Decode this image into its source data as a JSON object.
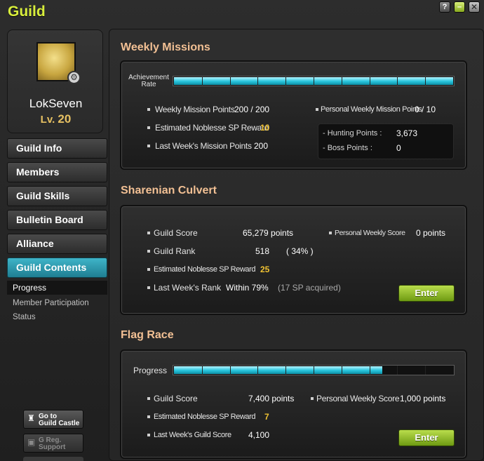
{
  "window": {
    "title": "Guild",
    "help": "?",
    "minimize": "–",
    "close": "✕"
  },
  "profile": {
    "name": "LokSeven",
    "level_prefix": "Lv.",
    "level": "20"
  },
  "nav": {
    "items": [
      "Guild Info",
      "Members",
      "Guild Skills",
      "Bulletin Board",
      "Alliance",
      "Guild Contents"
    ],
    "active": "Guild Contents",
    "sub": [
      "Progress",
      "Member Participation Status"
    ]
  },
  "bottom_buttons": {
    "castle": [
      "Go to",
      "Guild Castle"
    ],
    "support": [
      "G Reg.",
      "Support"
    ]
  },
  "weekly": {
    "title": "Weekly Missions",
    "bar_label": [
      "Achievement",
      "Rate"
    ],
    "achievement_fraction": 1.0,
    "rows": [
      {
        "label": "Weekly Mission Points",
        "value": "200 / 200"
      },
      {
        "label": "Estimated Noblesse SP Reward",
        "value": "10"
      },
      {
        "label": "Last Week's Mission Points",
        "value": "200"
      }
    ],
    "personal": {
      "label": "Personal Weekly Mission Points",
      "value": "0 / 10"
    },
    "breakdown": [
      {
        "label": "- Hunting Points :",
        "value": "3,673"
      },
      {
        "label": "- Boss Points :",
        "value": "0"
      }
    ]
  },
  "culvert": {
    "title": "Sharenian Culvert",
    "score": {
      "label": "Guild Score",
      "value": "65,279 points"
    },
    "personal": {
      "label": "Personal Weekly Score",
      "value": "0 points"
    },
    "rank": {
      "label": "Guild Rank",
      "value": "518",
      "pct": "( 34% )"
    },
    "reward": {
      "label": "Estimated Noblesse SP Reward",
      "value": "25"
    },
    "last": {
      "label": "Last Week's Rank",
      "value": "Within 79%",
      "note": "(17 SP acquired)"
    },
    "enter": "Enter"
  },
  "flag": {
    "title": "Flag Race",
    "progress_label": "Progress",
    "progress_fraction": 0.745,
    "score": {
      "label": "Guild Score",
      "value": "7,400 points"
    },
    "personal": {
      "label": "Personal Weekly Score",
      "value": "1,000 points"
    },
    "reward": {
      "label": "Estimated Noblesse SP Reward",
      "value": "7"
    },
    "last": {
      "label": "Last Week's Guild Score",
      "value": "4,100"
    },
    "enter": "Enter"
  },
  "colors": {
    "accent_title": "#d8ee3c",
    "section_title": "#f2c094",
    "bar_fill": "#26c4dc",
    "active_nav": "#2a98ae",
    "highlight": "#f0c232",
    "enter_button": "#8fbf24"
  }
}
